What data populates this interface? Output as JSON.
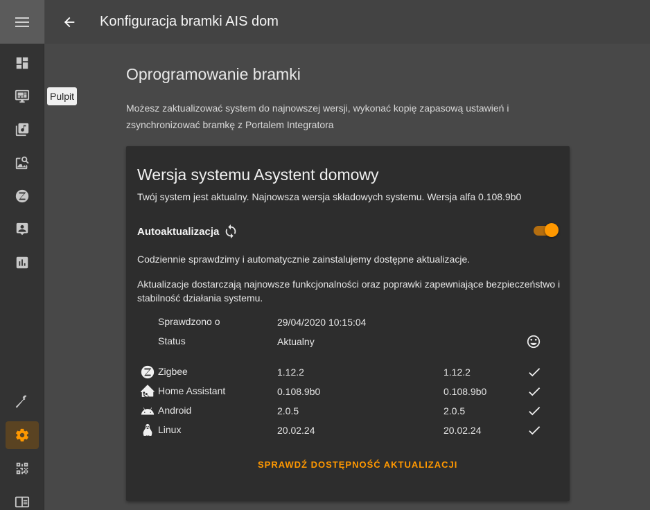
{
  "header": {
    "title": "Konfiguracja bramki AIS dom"
  },
  "tooltip": {
    "text": "Pulpit"
  },
  "section": {
    "title": "Oprogramowanie bramki",
    "description": "Możesz zaktualizować system do najnowszej wersji, wykonać kopię zapasową ustawień i zsynchronizować bramkę z Portalem Integratora"
  },
  "card": {
    "title": "Wersja systemu Asystent domowy",
    "subtitle": "Twój system jest aktualny. Najnowsza wersja składowych systemu. Wersja alfa 0.108.9b0",
    "auto_label": "Autoaktualizacja",
    "auto_enabled": true,
    "para1": "Codziennie sprawdzimy i automatycznie zainstalujemy dostępne aktualizacje.",
    "para2": "Aktualizacje dostarczają najnowsze funkcjonalności oraz poprawki zapewniające bezpieczeństwo i stabilność działania systemu.",
    "checked_label": "Sprawdzono o",
    "checked_value": "29/04/2020 10:15:04",
    "status_label": "Status",
    "status_value": "Aktualny",
    "components": [
      {
        "name": "Zigbee",
        "current": "1.12.2",
        "latest": "1.12.2",
        "icon": "zigbee-icon"
      },
      {
        "name": "Home Assistant",
        "current": "0.108.9b0",
        "latest": "0.108.9b0",
        "icon": "home-assistant-icon"
      },
      {
        "name": "Android",
        "current": "2.0.5",
        "latest": "2.0.5",
        "icon": "android-icon"
      },
      {
        "name": "Linux",
        "current": "20.02.24",
        "latest": "20.02.24",
        "icon": "linux-icon"
      }
    ],
    "check_button": "SPRAWDŹ DOSTĘPNOŚĆ AKTUALIZACJI"
  },
  "colors": {
    "accent": "#ff9800",
    "sidebar": "#333333",
    "header": "#434343",
    "background": "#484848",
    "card": "#2d2d2d"
  }
}
